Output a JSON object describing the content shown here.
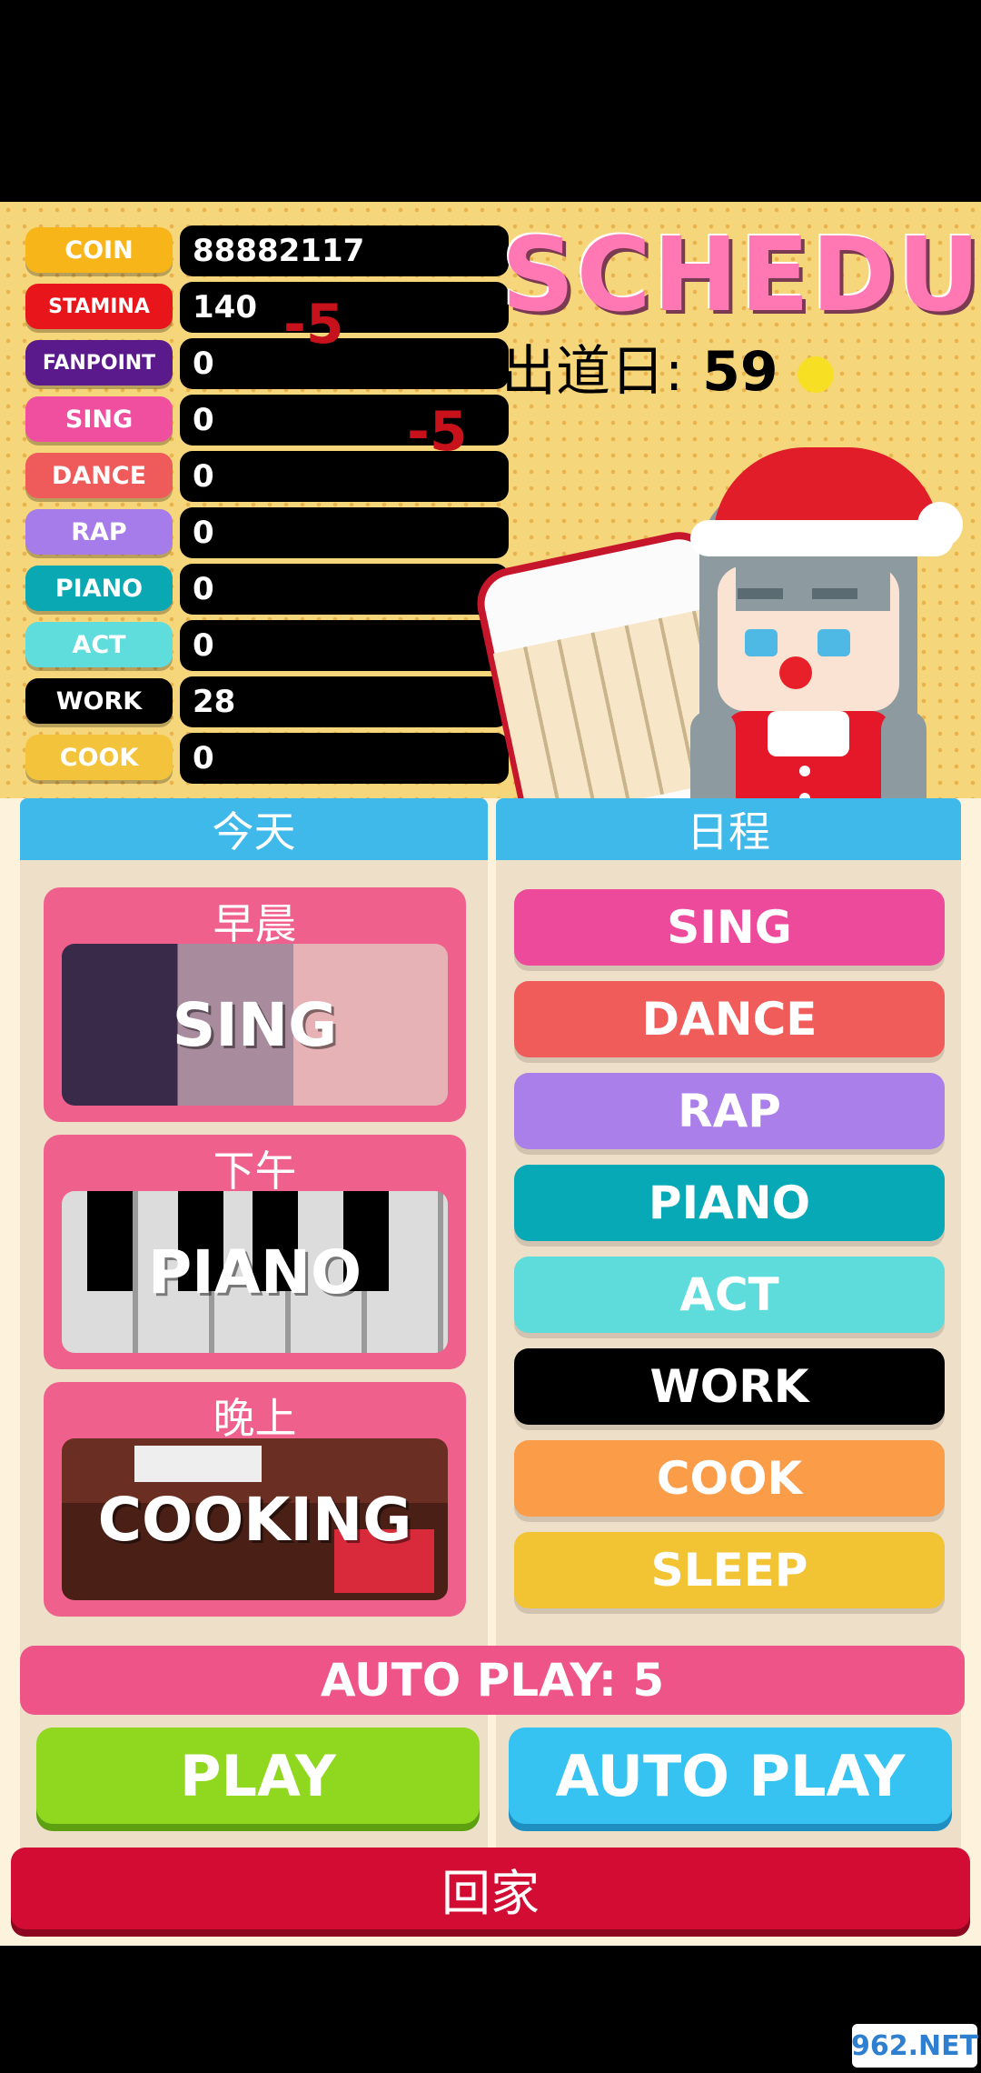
{
  "stats": [
    {
      "label": "COIN",
      "value": "88882117",
      "color": "#f7b51a"
    },
    {
      "label": "STAMINA",
      "value": "140",
      "color": "#e8151b"
    },
    {
      "label": "FANPOINT",
      "value": "0",
      "color": "#5a1a8c"
    },
    {
      "label": "SING",
      "value": "0",
      "color": "#f04fa0"
    },
    {
      "label": "DANCE",
      "value": "0",
      "color": "#ef5b5a"
    },
    {
      "label": "RAP",
      "value": "0",
      "color": "#a67bea"
    },
    {
      "label": "PIANO",
      "value": "0",
      "color": "#0aa8b3"
    },
    {
      "label": "ACT",
      "value": "0",
      "color": "#5fdcdc"
    },
    {
      "label": "WORK",
      "value": "28",
      "color": "#000000"
    },
    {
      "label": "COOK",
      "value": "0",
      "color": "#f3c43b"
    }
  ],
  "floating_numbers": [
    "-5",
    "-5"
  ],
  "schedule_title": "SCHEDULE",
  "debut_label": "出道日:",
  "debut_value": "59",
  "today_header": "今天",
  "schedule_header": "日程",
  "slots": [
    {
      "time": "早晨",
      "activity": "SING"
    },
    {
      "time": "下午",
      "activity": "PIANO"
    },
    {
      "time": "晚上",
      "activity": "COOKING"
    }
  ],
  "schedule_options": [
    {
      "label": "SING",
      "color": "#ee4a9c"
    },
    {
      "label": "DANCE",
      "color": "#f05c5a"
    },
    {
      "label": "RAP",
      "color": "#ab7fea"
    },
    {
      "label": "PIANO",
      "color": "#07a9b6"
    },
    {
      "label": "ACT",
      "color": "#5edcdc"
    },
    {
      "label": "WORK",
      "color": "#000000"
    },
    {
      "label": "COOK",
      "color": "#fa9c48"
    },
    {
      "label": "SLEEP",
      "color": "#f2c434"
    }
  ],
  "auto_play_status": "AUTO PLAY: 5",
  "play_label": "PLAY",
  "auto_play_label": "AUTO PLAY",
  "home_label": "回家",
  "watermark": "962.NET"
}
